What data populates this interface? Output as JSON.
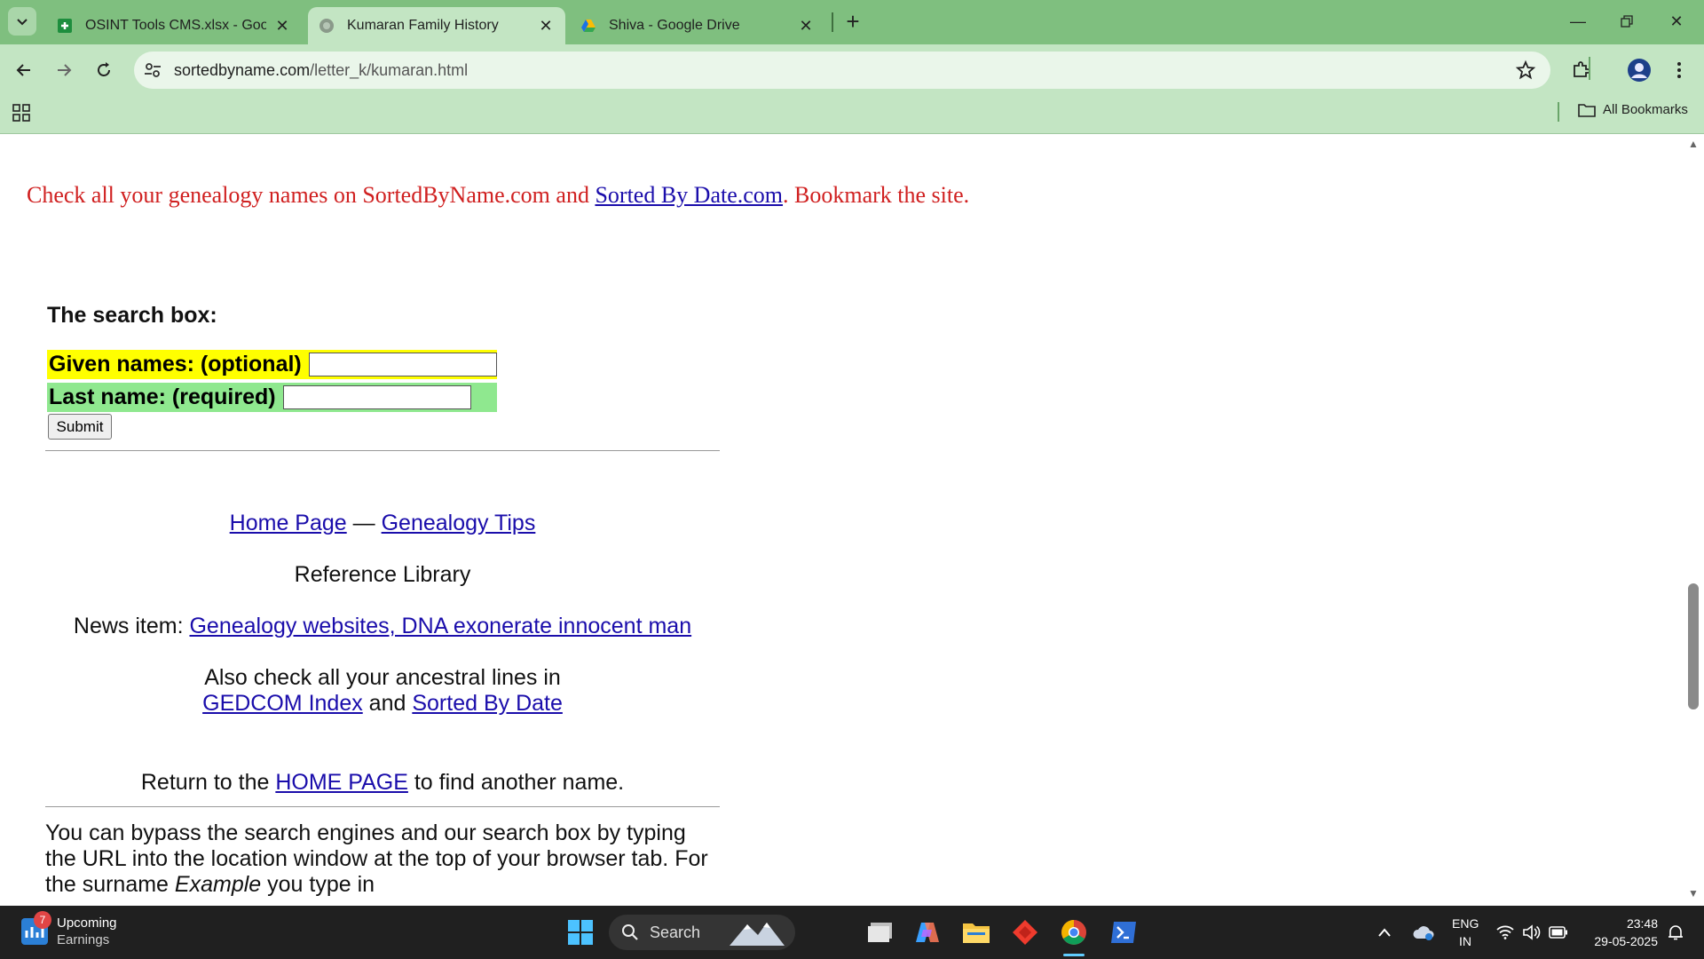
{
  "browser": {
    "tabs": [
      {
        "title": "OSINT Tools CMS.xlsx - Google",
        "favicon": "sheets-icon"
      },
      {
        "title": "Kumaran Family History",
        "favicon": "globe-icon",
        "active": true
      },
      {
        "title": "Shiva - Google Drive",
        "favicon": "drive-icon"
      }
    ],
    "url_host": "sortedbyname.com",
    "url_path": "/letter_k/kumaran.html",
    "all_bookmarks_label": "All Bookmarks"
  },
  "page": {
    "promo": {
      "before": "Check all your genealogy names on SortedByName.com and ",
      "link": "Sorted By Date.com",
      "after": ". Bookmark the site."
    },
    "search": {
      "heading": "The search box:",
      "given_label": "Given names: (optional)",
      "given_value": "",
      "last_label": "Last name: (required)",
      "last_value": "",
      "submit_label": "Submit"
    },
    "links_line": {
      "home": "Home Page",
      "dash": " — ",
      "tips": "Genealogy Tips"
    },
    "reference": "Reference Library",
    "news": {
      "prefix": "News item: ",
      "link": "Genealogy websites, DNA exonerate innocent man"
    },
    "also": {
      "line1": "Also check all your ancestral lines in",
      "gedcom": "GEDCOM Index",
      "and": " and ",
      "sorted": "Sorted By Date"
    },
    "return": {
      "before": "Return to the ",
      "link": "HOME PAGE",
      "after": " to find another name."
    },
    "bypass": {
      "text": "You can bypass the search engines and our search box by typing the URL into the location window at the top of your browser tab. For the surname ",
      "example": "Example",
      "after": " you type in"
    }
  },
  "taskbar": {
    "widget_badge": "7",
    "widget_title": "Upcoming",
    "widget_subtitle": "Earnings",
    "search_label": "Search",
    "lang_line1": "ENG",
    "lang_line2": "IN",
    "time": "23:48",
    "date": "29-05-2025"
  },
  "colors": {
    "tabbar": "#7fbf7f",
    "toolbar": "#c3e5c3",
    "promo_text": "#d02020",
    "given_bg": "#ffff00",
    "last_bg": "#8fe88f",
    "link": "#1a0dab"
  }
}
